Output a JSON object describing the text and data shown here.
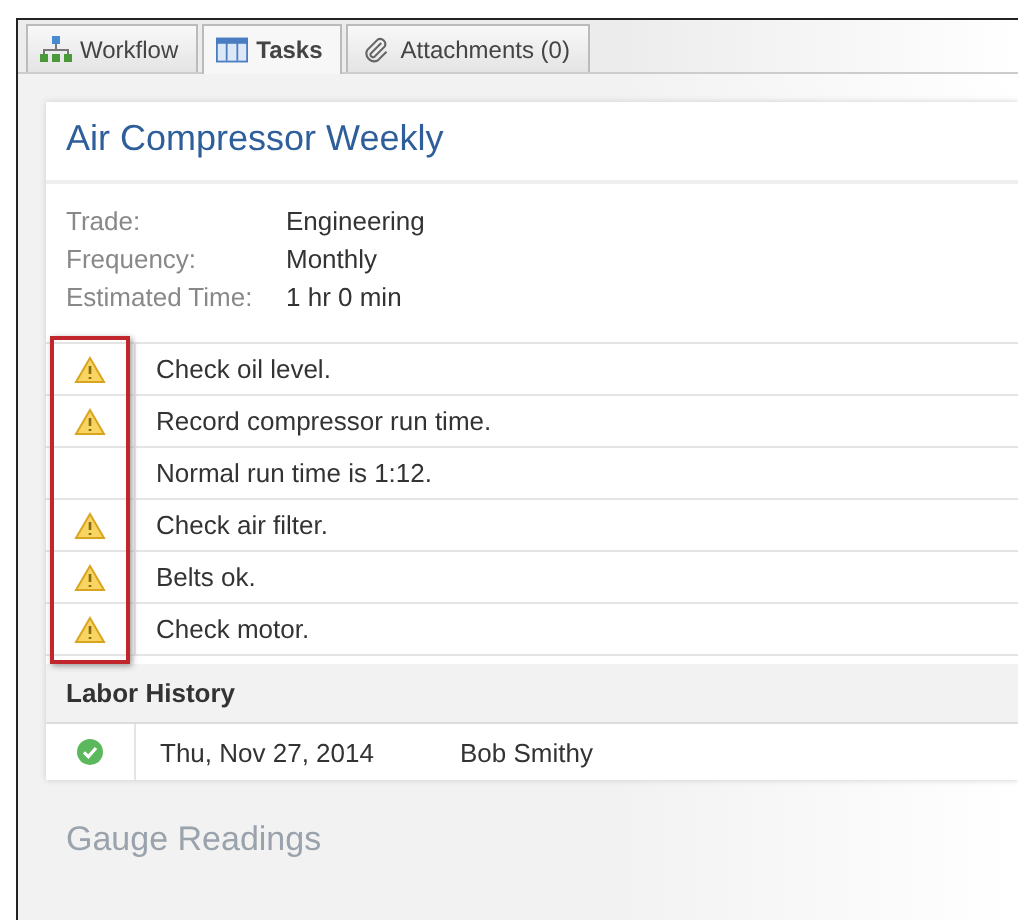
{
  "tabs": [
    {
      "label": "Workflow",
      "kind": "workflow",
      "selected": false
    },
    {
      "label": "Tasks",
      "kind": "tasks",
      "selected": true
    },
    {
      "label": "Attachments (0)",
      "kind": "clip",
      "selected": false
    }
  ],
  "title": "Air Compressor Weekly",
  "details": [
    {
      "label": "Trade:",
      "value": "Engineering"
    },
    {
      "label": "Frequency:",
      "value": "Monthly"
    },
    {
      "label": "Estimated Time:",
      "value": "1 hr 0 min"
    }
  ],
  "tasks": [
    {
      "text": "Check oil level.",
      "warning": true
    },
    {
      "text": "Record compressor run time.",
      "warning": true
    },
    {
      "text": "Normal run time is 1:12.",
      "warning": false
    },
    {
      "text": "Check air filter.",
      "warning": true
    },
    {
      "text": "Belts ok.",
      "warning": true
    },
    {
      "text": "Check motor.",
      "warning": true
    }
  ],
  "labor_history": {
    "heading": "Labor History",
    "rows": [
      {
        "done": true,
        "date": "Thu, Nov 27, 2014",
        "name": "Bob Smithy"
      }
    ]
  },
  "next_section": "Gauge Readings"
}
